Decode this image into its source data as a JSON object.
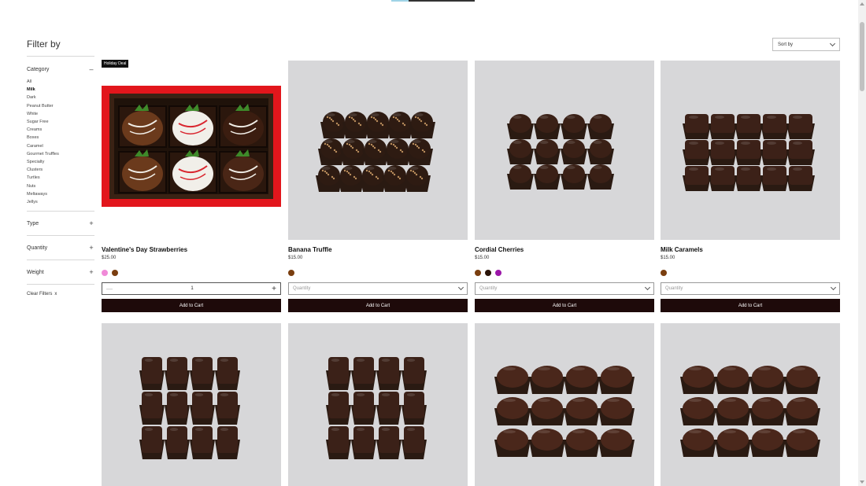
{
  "sidebar": {
    "title": "Filter by",
    "category": {
      "label": "Category",
      "toggle": "–",
      "items": [
        "All",
        "Milk",
        "Dark",
        "Peanut Butter",
        "White",
        "Sugar Free",
        "Creams",
        "Boxes",
        "Caramel",
        "Gourmet Truffles",
        "Specialty",
        "Clusters",
        "Turtles",
        "Nuts",
        "Meltaways",
        "Jellys"
      ],
      "active": "Milk"
    },
    "type": {
      "label": "Type",
      "toggle": "+"
    },
    "quantity": {
      "label": "Quantity",
      "toggle": "+"
    },
    "weight": {
      "label": "Weight",
      "toggle": "+"
    },
    "clear": {
      "label": "Clear Filters",
      "icon": "x"
    }
  },
  "sort": {
    "label": "Sort by"
  },
  "products": [
    {
      "badge": "Holiday Deal",
      "name": "Valentine's Day Strawberries",
      "price": "$25.00",
      "swatches": [
        "#f08ad8",
        "#7a3e0f"
      ],
      "quantity_value": "1",
      "minus": "—",
      "plus": "+",
      "add_label": "Add to Cart",
      "image": "strawberry-box"
    },
    {
      "name": "Banana Truffle",
      "price": "$15.00",
      "swatches": [
        "#7a3e0f"
      ],
      "quantity_placeholder": "Quantity",
      "add_label": "Add to Cart",
      "image": "truffles"
    },
    {
      "name": "Cordial Cherries",
      "price": "$15.00",
      "swatches": [
        "#7a3e0f",
        "#2a1408",
        "#9b16a8"
      ],
      "quantity_placeholder": "Quantity",
      "add_label": "Add to Cart",
      "image": "cherries"
    },
    {
      "name": "Milk Caramels",
      "price": "$15.00",
      "swatches": [
        "#7a3e0f"
      ],
      "quantity_placeholder": "Quantity",
      "add_label": "Add to Cart",
      "image": "caramels"
    },
    {
      "image": "bars"
    },
    {
      "image": "bars"
    },
    {
      "image": "clusters"
    },
    {
      "image": "clusters"
    }
  ]
}
